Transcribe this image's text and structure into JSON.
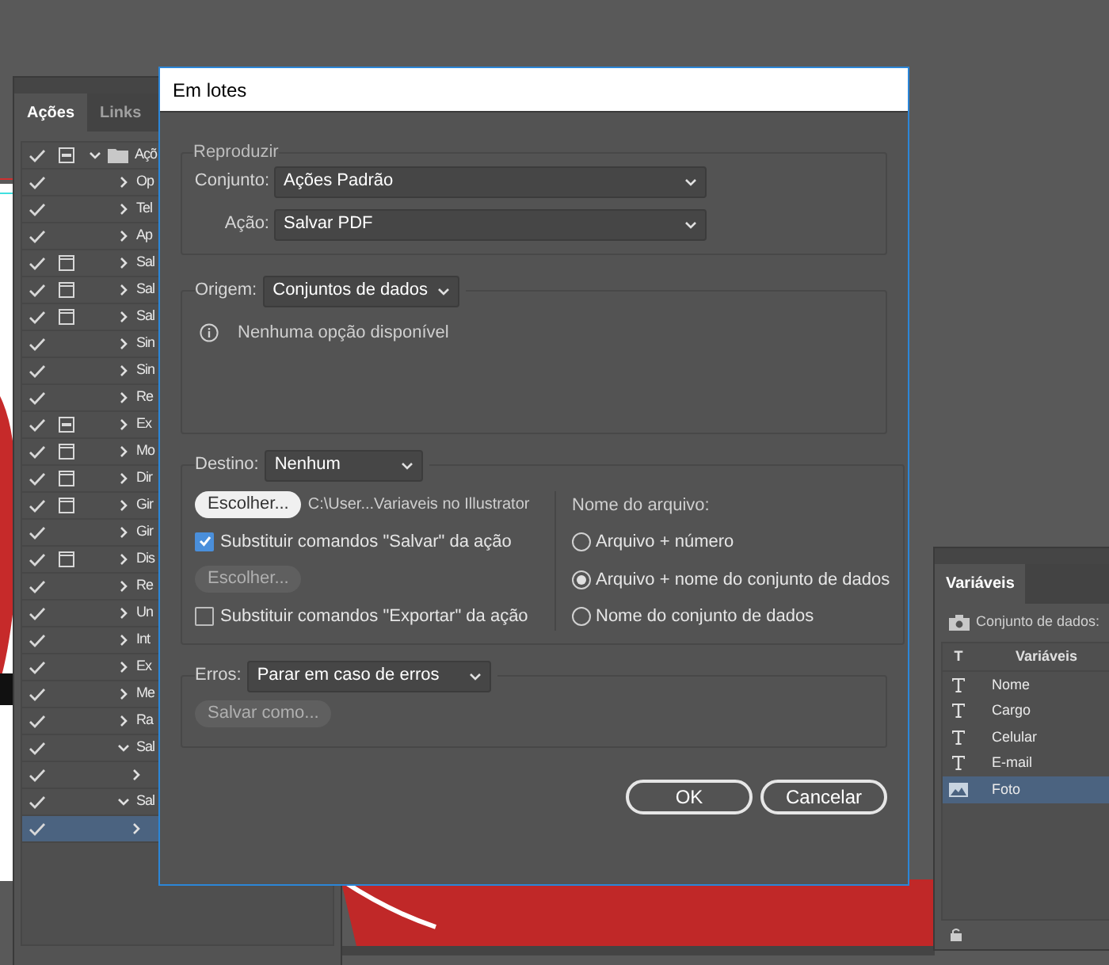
{
  "actions_panel": {
    "tabs": [
      {
        "label": "Ações",
        "selected": true
      },
      {
        "label": "Links",
        "selected": false
      }
    ],
    "rows": [
      {
        "name": "Açõ",
        "checked": true,
        "dialog_toggle": true,
        "dialog_mixed": true,
        "expanded": true,
        "selected": false,
        "folder": true,
        "children": [
          {
            "name": "Op",
            "checked": true,
            "dialog_toggle": false,
            "dialog_mixed": false,
            "expanded": false,
            "selected": false
          },
          {
            "name": "Tel",
            "checked": true,
            "dialog_toggle": false,
            "dialog_mixed": false,
            "expanded": false,
            "selected": false
          },
          {
            "name": "Ap",
            "checked": true,
            "dialog_toggle": false,
            "dialog_mixed": false,
            "expanded": false,
            "selected": false
          },
          {
            "name": "Sal",
            "checked": true,
            "dialog_toggle": true,
            "dialog_mixed": false,
            "expanded": false,
            "selected": false
          },
          {
            "name": "Sal",
            "checked": true,
            "dialog_toggle": true,
            "dialog_mixed": false,
            "expanded": false,
            "selected": false
          },
          {
            "name": "Sal",
            "checked": true,
            "dialog_toggle": true,
            "dialog_mixed": false,
            "expanded": false,
            "selected": false
          },
          {
            "name": "Sin",
            "checked": true,
            "dialog_toggle": false,
            "dialog_mixed": false,
            "expanded": false,
            "selected": false
          },
          {
            "name": "Sin",
            "checked": true,
            "dialog_toggle": false,
            "dialog_mixed": false,
            "expanded": false,
            "selected": false
          },
          {
            "name": "Re",
            "checked": true,
            "dialog_toggle": false,
            "dialog_mixed": false,
            "expanded": false,
            "selected": false
          },
          {
            "name": "Ex",
            "checked": true,
            "dialog_toggle": true,
            "dialog_mixed": true,
            "expanded": false,
            "selected": false
          },
          {
            "name": "Mo",
            "checked": true,
            "dialog_toggle": true,
            "dialog_mixed": false,
            "expanded": false,
            "selected": false
          },
          {
            "name": "Dir",
            "checked": true,
            "dialog_toggle": true,
            "dialog_mixed": false,
            "expanded": false,
            "selected": false
          },
          {
            "name": "Gir",
            "checked": true,
            "dialog_toggle": true,
            "dialog_mixed": false,
            "expanded": false,
            "selected": false
          },
          {
            "name": "Gir",
            "checked": true,
            "dialog_toggle": false,
            "dialog_mixed": false,
            "expanded": false,
            "selected": false
          },
          {
            "name": "Dis",
            "checked": true,
            "dialog_toggle": true,
            "dialog_mixed": false,
            "expanded": false,
            "selected": false
          },
          {
            "name": "Re",
            "checked": true,
            "dialog_toggle": false,
            "dialog_mixed": false,
            "expanded": false,
            "selected": false
          },
          {
            "name": "Un",
            "checked": true,
            "dialog_toggle": false,
            "dialog_mixed": false,
            "expanded": false,
            "selected": false
          },
          {
            "name": "Int",
            "checked": true,
            "dialog_toggle": false,
            "dialog_mixed": false,
            "expanded": false,
            "selected": false
          },
          {
            "name": "Ex",
            "checked": true,
            "dialog_toggle": false,
            "dialog_mixed": false,
            "expanded": false,
            "selected": false
          },
          {
            "name": "Me",
            "checked": true,
            "dialog_toggle": false,
            "dialog_mixed": false,
            "expanded": false,
            "selected": false
          },
          {
            "name": "Ra",
            "checked": true,
            "dialog_toggle": false,
            "dialog_mixed": false,
            "expanded": false,
            "selected": false
          },
          {
            "name": "Sal",
            "checked": true,
            "dialog_toggle": false,
            "dialog_mixed": false,
            "expanded": true,
            "selected": false,
            "children": [
              {
                "checked": true,
                "dialog_toggle": false,
                "dialog_mixed": false,
                "expanded": false,
                "selected": false
              }
            ]
          },
          {
            "name": "Sal",
            "checked": true,
            "dialog_toggle": false,
            "dialog_mixed": false,
            "expanded": true,
            "selected": false,
            "children": [
              {
                "checked": true,
                "dialog_toggle": false,
                "dialog_mixed": false,
                "expanded": false,
                "selected": true
              }
            ]
          }
        ]
      }
    ]
  },
  "dialog": {
    "title": "Em lotes",
    "play": {
      "legend": "Reproduzir",
      "set_label": "Conjunto:",
      "set_value": "Ações Padrão",
      "action_label": "Ação:",
      "action_value": "Salvar PDF"
    },
    "source": {
      "label": "Origem:",
      "value": "Conjuntos de dados",
      "info": "Nenhuma opção disponível"
    },
    "destination": {
      "label": "Destino:",
      "value": "Nenhum",
      "choose_button": {
        "label": "Escolher...",
        "disabled": false
      },
      "path": "C:\\User...Variaveis no Illustrator",
      "override_save": {
        "label": "Substituir comandos \"Salvar\" da ação",
        "checked": true
      },
      "choose_button_2": {
        "label": "Escolher...",
        "disabled": true
      },
      "override_export": {
        "label": "Substituir comandos \"Exportar\" da ação",
        "checked": false
      },
      "filename_label": "Nome do arquivo:",
      "filename_options": [
        {
          "label": "Arquivo + número",
          "selected": false
        },
        {
          "label": "Arquivo + nome do conjunto de dados",
          "selected": true
        },
        {
          "label": "Nome do conjunto de dados",
          "selected": false
        }
      ]
    },
    "errors": {
      "label": "Erros:",
      "value": "Parar em caso de erros",
      "save_as_button": {
        "label": "Salvar como...",
        "disabled": true
      }
    },
    "buttons": [
      "OK",
      "Cancelar"
    ]
  },
  "variables_panel": {
    "tab": "Variáveis",
    "dataset_label": "Conjunto de dados:",
    "header_type": "T",
    "header_name": "Variáveis",
    "rows": [
      {
        "kind": "text",
        "name": "Nome",
        "selected": false
      },
      {
        "kind": "text",
        "name": "Cargo",
        "selected": false
      },
      {
        "kind": "text",
        "name": "Celular",
        "selected": false
      },
      {
        "kind": "text",
        "name": "E-mail",
        "selected": false
      },
      {
        "kind": "image",
        "name": "Foto",
        "selected": true
      }
    ]
  }
}
